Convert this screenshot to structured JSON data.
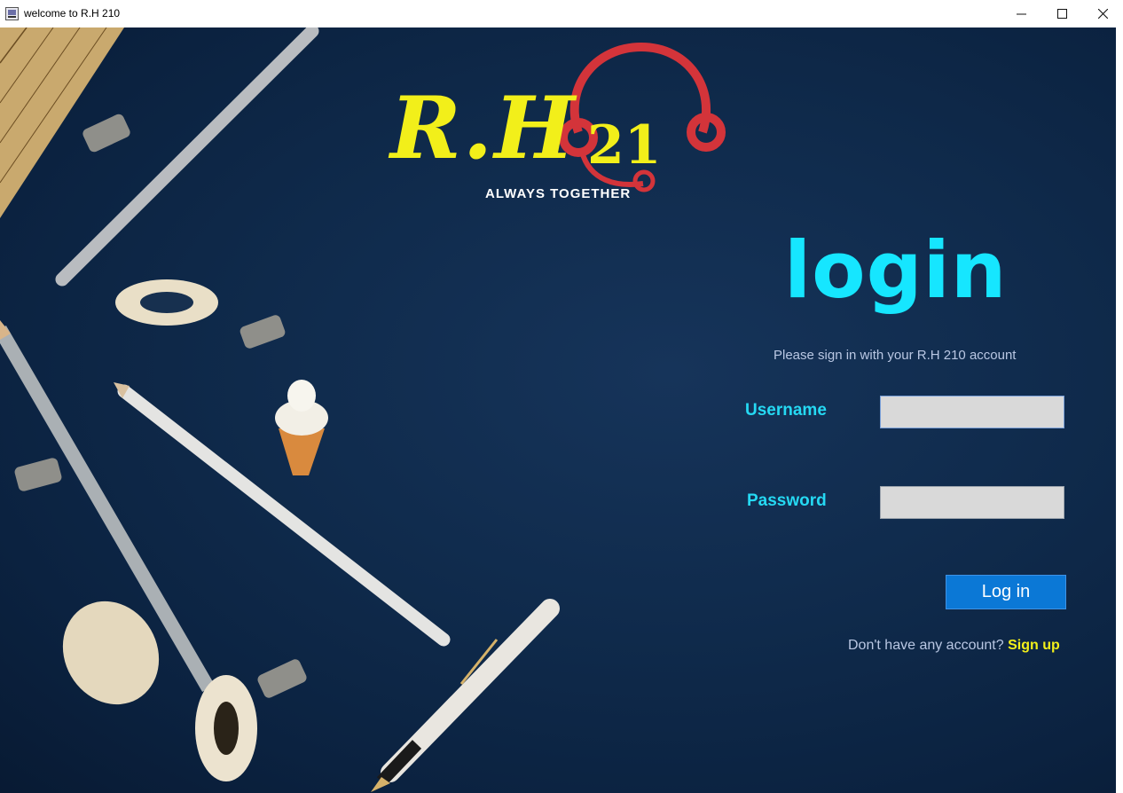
{
  "window": {
    "title": "welcome to R.H 210",
    "minimize": "—",
    "maximize": "☐",
    "close": "✕"
  },
  "logo": {
    "text": "R.H",
    "number": "21",
    "tagline": "ALWAYS TOGETHER"
  },
  "login": {
    "heading": "login",
    "subtitle": "Please sign in with your R.H 210 account",
    "username_label": "Username",
    "username_value": "",
    "password_label": "Password",
    "password_value": "",
    "login_button": "Log in",
    "no_account_text": "Don't have any account?",
    "signup_link": "Sign up"
  },
  "colors": {
    "background": "#0f2a4b",
    "heading": "#16e6ff",
    "label": "#25d9f3",
    "accent": "#f2ef1a",
    "button": "#0b78d6",
    "headset": "#d3343a"
  },
  "icons": [
    "app-icon",
    "minimize-icon",
    "maximize-icon",
    "close-icon",
    "headset-icon"
  ]
}
